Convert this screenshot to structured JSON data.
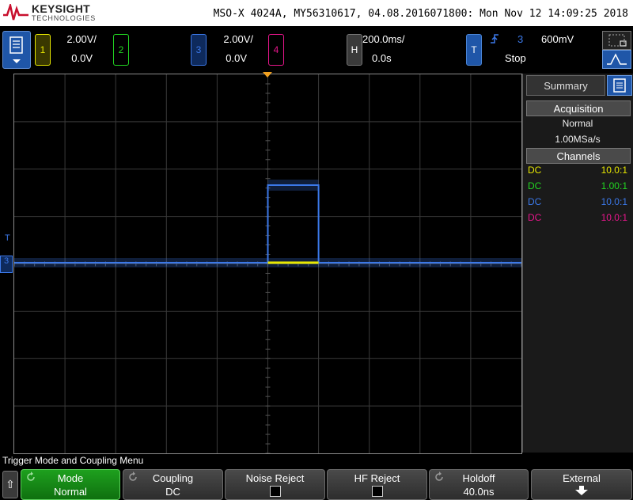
{
  "header": {
    "brand": "KEYSIGHT",
    "brand_sub": "TECHNOLOGIES",
    "instrument_id": "MSO-X 4024A, MY56310617, 04.08.2016071800: Mon Nov 12 14:09:25 2018"
  },
  "channels": [
    {
      "num": "1",
      "scale": "2.00V/",
      "offset": "0.0V",
      "color": "#e8e800"
    },
    {
      "num": "2",
      "scale": "",
      "offset": "",
      "color": "#22d622"
    },
    {
      "num": "3",
      "scale": "2.00V/",
      "offset": "0.0V",
      "color": "#3b78e8"
    },
    {
      "num": "4",
      "scale": "",
      "offset": "",
      "color": "#e8168c"
    }
  ],
  "horizontal": {
    "label": "H",
    "scale": "200.0ms/",
    "delay": "0.0s"
  },
  "trigger": {
    "label": "T",
    "source": "3",
    "level": "600mV",
    "state": "Stop"
  },
  "markers": {
    "trigger_level": "T",
    "channel3": "3"
  },
  "side_panel": {
    "tab": "Summary",
    "acquisition_header": "Acquisition",
    "acq_mode": "Normal",
    "sample_rate": "1.00MSa/s",
    "channels_header": "Channels",
    "channel_rows": [
      {
        "coupling": "DC",
        "probe": "10.0:1",
        "color": "#e8e800"
      },
      {
        "coupling": "DC",
        "probe": "1.00:1",
        "color": "#22d622"
      },
      {
        "coupling": "DC",
        "probe": "10.0:1",
        "color": "#3b78e8"
      },
      {
        "coupling": "DC",
        "probe": "10.0:1",
        "color": "#e8168c"
      }
    ]
  },
  "menu": {
    "title": "Trigger Mode and Coupling Menu",
    "softkeys": [
      {
        "label": "Mode",
        "value": "Normal",
        "active": true
      },
      {
        "label": "Coupling",
        "value": "DC",
        "active": false
      },
      {
        "label": "Noise Reject",
        "value": "",
        "checkbox": true,
        "checked": false
      },
      {
        "label": "HF Reject",
        "value": "",
        "checkbox": true,
        "checked": false
      },
      {
        "label": "Holdoff",
        "value": "40.0ns",
        "active": false
      },
      {
        "label": "External",
        "value": "",
        "active": false
      }
    ]
  },
  "colors": {
    "ch1": "#e8e800",
    "ch3": "#3b78e8",
    "accent": "#1f56a8",
    "active_key": "#1ea01e"
  },
  "icons": [
    "keysight-logo-icon",
    "menu-icon",
    "rising-edge-icon",
    "zoom-icon",
    "autoscale-icon",
    "back-arrow-icon",
    "rotary-knob-icon",
    "down-arrow-icon"
  ]
}
